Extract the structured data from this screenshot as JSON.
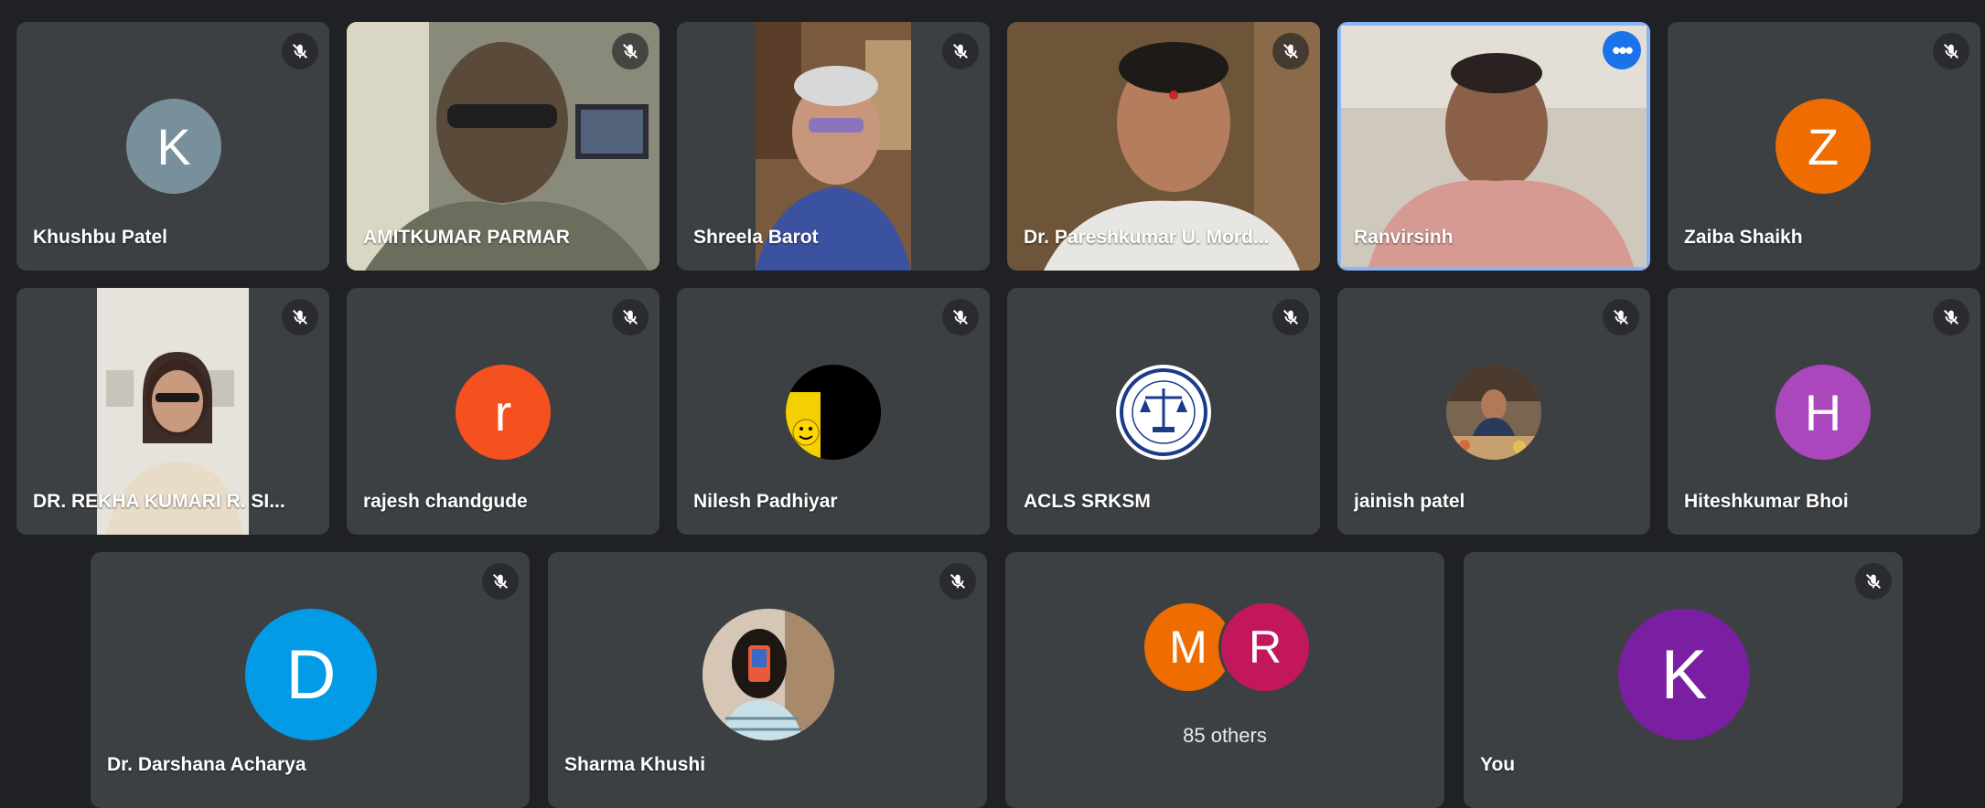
{
  "participants": [
    {
      "name": "Khushbu Patel",
      "initial": "K",
      "avatar_color": "#78909c"
    },
    {
      "name": "AMITKUMAR PARMAR"
    },
    {
      "name": "Shreela Barot"
    },
    {
      "name": "Dr. Pareshkumar U. Mord..."
    },
    {
      "name": "Ranvirsinh"
    },
    {
      "name": "Zaiba Shaikh",
      "initial": "Z",
      "avatar_color": "#ef6c00"
    },
    {
      "name": "DR. REKHA KUMARI R. SI..."
    },
    {
      "name": "rajesh chandgude",
      "initial": "r",
      "avatar_color": "#f4511e"
    },
    {
      "name": "Nilesh Padhiyar"
    },
    {
      "name": "ACLS SRKSM"
    },
    {
      "name": "jainish patel"
    },
    {
      "name": "Hiteshkumar Bhoi",
      "initial": "H",
      "avatar_color": "#ab47bc"
    },
    {
      "name": "Dr. Darshana Acharya",
      "initial": "D",
      "avatar_color": "#039be5"
    },
    {
      "name": "Sharma Khushi"
    },
    {
      "name": "You",
      "initial": "K",
      "avatar_color": "#7b1fa2"
    }
  ],
  "others": {
    "label": "85 others",
    "avatars": [
      {
        "initial": "M",
        "color": "#ef6c00"
      },
      {
        "initial": "R",
        "color": "#c2185b"
      }
    ]
  },
  "icons": {
    "mute": "mic-off-icon",
    "more": "more-options-icon"
  }
}
